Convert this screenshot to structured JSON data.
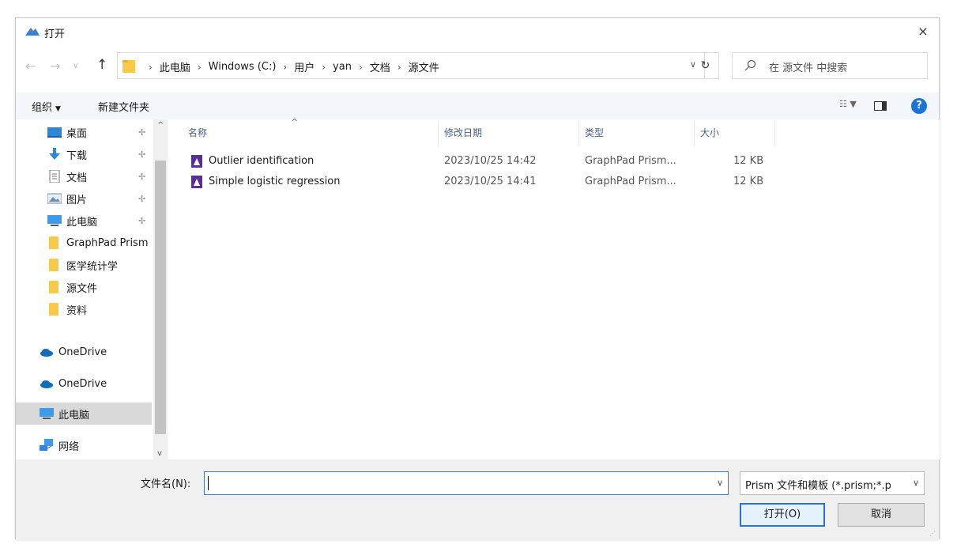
{
  "window": {
    "title": "打开",
    "close_label": "×"
  },
  "address": {
    "crumbs": [
      "此电脑",
      "Windows (C:)",
      "用户",
      "yan",
      "文档",
      "源文件"
    ],
    "search_placeholder": "在 源文件 中搜索"
  },
  "toolbar": {
    "organize_label": "组织",
    "new_folder_label": "新建文件夹"
  },
  "nav": {
    "items": [
      {
        "label": "桌面",
        "icon": "desktop-icon",
        "pinned": true
      },
      {
        "label": "下载",
        "icon": "download-icon",
        "pinned": true
      },
      {
        "label": "文档",
        "icon": "document-icon",
        "pinned": true
      },
      {
        "label": "图片",
        "icon": "pictures-icon",
        "pinned": true
      },
      {
        "label": "此电脑",
        "icon": "computer-icon",
        "pinned": true
      },
      {
        "label": "GraphPad Prism",
        "icon": "folder-icon",
        "pinned": false
      },
      {
        "label": "医学统计学",
        "icon": "folder-icon",
        "pinned": false
      },
      {
        "label": "源文件",
        "icon": "folder-icon",
        "pinned": false
      },
      {
        "label": "资料",
        "icon": "folder-icon",
        "pinned": false
      }
    ],
    "roots": [
      {
        "label": "OneDrive",
        "icon": "onedrive-icon"
      },
      {
        "label": "OneDrive",
        "icon": "onedrive-icon"
      },
      {
        "label": "此电脑",
        "icon": "computer-icon",
        "selected": true
      },
      {
        "label": "网络",
        "icon": "network-icon"
      }
    ]
  },
  "columns": {
    "name": "名称",
    "date": "修改日期",
    "type": "类型",
    "size": "大小"
  },
  "files": [
    {
      "name": "Outlier identification",
      "date": "2023/10/25 14:42",
      "type": "GraphPad Prism...",
      "size": "12 KB"
    },
    {
      "name": "Simple logistic regression",
      "date": "2023/10/25 14:41",
      "type": "GraphPad Prism...",
      "size": "12 KB"
    }
  ],
  "bottom": {
    "filename_label": "文件名(N):",
    "filename_value": "",
    "filter_value": "Prism 文件和模板 (*.prism;*.p",
    "open_label": "打开(O)",
    "cancel_label": "取消"
  },
  "colors": {
    "accent": "#2a70d6",
    "folder": "#f7c948",
    "prism_file": "#5b2f91"
  }
}
